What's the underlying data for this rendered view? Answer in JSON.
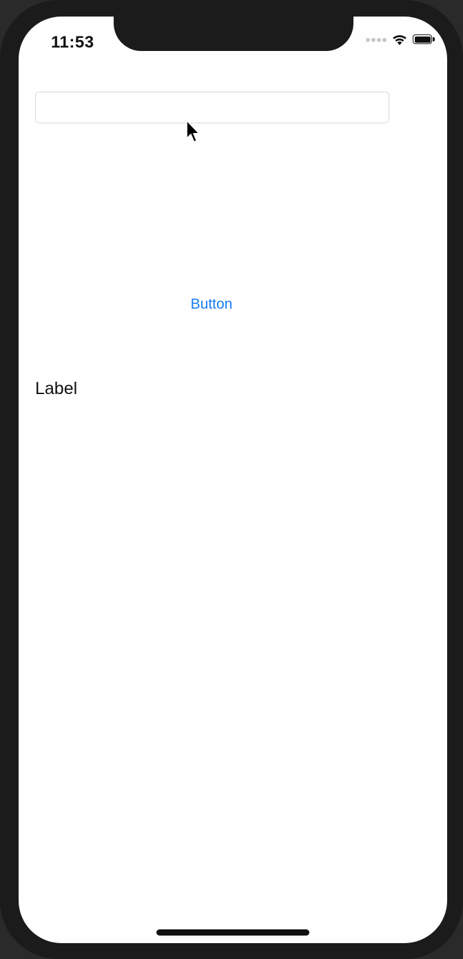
{
  "status_bar": {
    "time": "11:53"
  },
  "form": {
    "text_field_value": "",
    "text_field_placeholder": ""
  },
  "button": {
    "label": "Button",
    "color": "#1a7cf0"
  },
  "label": {
    "text": "Label"
  },
  "icons": {
    "cellular": "cellular-signal-icon",
    "wifi": "wifi-icon",
    "battery": "battery-icon",
    "cursor": "mouse-pointer-icon"
  }
}
